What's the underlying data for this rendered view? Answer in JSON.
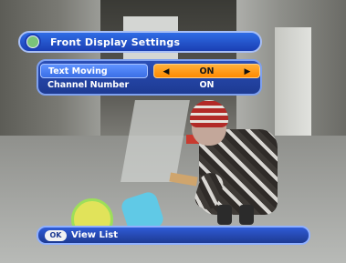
{
  "osd": {
    "title": "Front Display Settings",
    "icon": "settings-icon",
    "rows": [
      {
        "label": "Text Moving",
        "value": "ON",
        "selected": true
      },
      {
        "label": "Channel Number",
        "value": "ON",
        "selected": false
      }
    ],
    "arrows": {
      "left": "◀",
      "right": "▶"
    }
  },
  "footer": {
    "key": "OK",
    "label": "View List"
  },
  "colors": {
    "osd_blue": "#1b3fb3",
    "selected_label": "#5f92ff",
    "selected_value": "#ff8a00",
    "text": "#ffffff"
  }
}
